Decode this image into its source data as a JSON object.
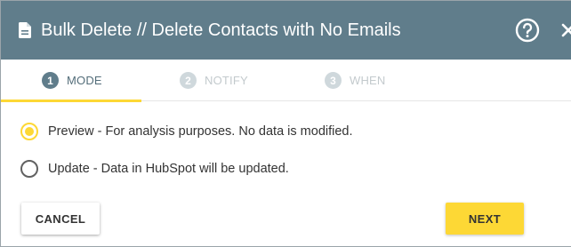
{
  "header": {
    "title": "Bulk Delete // Delete Contacts with No Emails",
    "icons": {
      "document": "document-icon",
      "help": "help-circle-icon",
      "close": "close-icon"
    }
  },
  "steps": [
    {
      "number": "1",
      "label": "MODE",
      "active": true
    },
    {
      "number": "2",
      "label": "NOTIFY",
      "active": false
    },
    {
      "number": "3",
      "label": "WHEN",
      "active": false
    }
  ],
  "options": [
    {
      "label": "Preview - For analysis purposes. No data is modified.",
      "selected": true
    },
    {
      "label": "Update - Data in HubSpot will be updated.",
      "selected": false
    }
  ],
  "buttons": {
    "cancel": "CANCEL",
    "next": "NEXT"
  },
  "colors": {
    "header_bg": "#607d8b",
    "accent": "#fdd835",
    "active_step": "#607d8b",
    "inactive_step": "#cfd8dc"
  }
}
